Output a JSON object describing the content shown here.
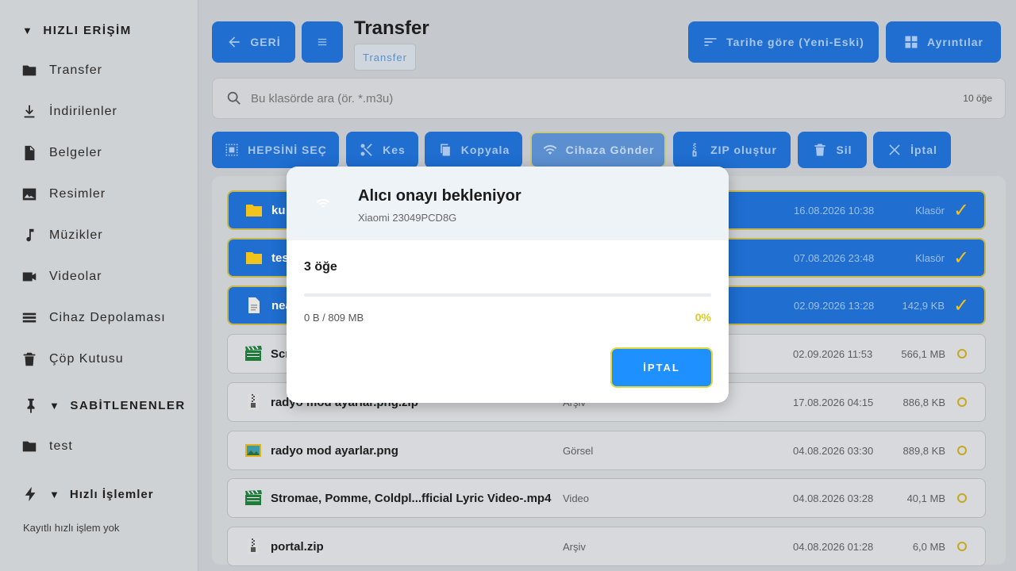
{
  "sidebar": {
    "quick_access": "HIZLI ERİŞİM",
    "items": [
      {
        "label": "Transfer",
        "icon": "folder-icon"
      },
      {
        "label": "İndirilenler",
        "icon": "download-icon"
      },
      {
        "label": "Belgeler",
        "icon": "document-icon"
      },
      {
        "label": "Resimler",
        "icon": "image-icon"
      },
      {
        "label": "Müzikler",
        "icon": "music-icon"
      },
      {
        "label": "Videolar",
        "icon": "video-icon"
      },
      {
        "label": "Cihaz Depolaması",
        "icon": "storage-icon"
      },
      {
        "label": "Çöp Kutusu",
        "icon": "trash-icon"
      }
    ],
    "pinned": "SABİTLENENLER",
    "pinned_items": [
      {
        "label": "test",
        "icon": "folder-icon"
      }
    ],
    "quick_actions": "Hızlı İşlemler",
    "quick_actions_empty": "Kayıtlı hızlı işlem yok"
  },
  "header": {
    "back_label": "GERİ",
    "title": "Transfer",
    "breadcrumb": "Transfer",
    "sort_label": "Tarihe göre (Yeni-Eski)",
    "view_label": "Ayrıntılar"
  },
  "search": {
    "placeholder": "Bu klasörde ara (ör. *.m3u)",
    "count": "10 öğe"
  },
  "toolbar": {
    "select_all": "HEPSİNİ SEÇ",
    "cut": "Kes",
    "copy": "Kopyala",
    "send": "Cihaza Gönder",
    "zip": "ZIP oluştur",
    "delete": "Sil",
    "cancel": "İptal"
  },
  "files": [
    {
      "name": "ku",
      "type": "",
      "date": "16.08.2026 10:38",
      "size": "Klasör",
      "selected": true
    },
    {
      "name": "tes",
      "type": "",
      "date": "07.08.2026 23:48",
      "size": "Klasör",
      "selected": true
    },
    {
      "name": "nea",
      "type": "",
      "date": "02.09.2026 13:28",
      "size": "142,9 KB",
      "selected": true
    },
    {
      "name": "Scr",
      "type": "",
      "date": "02.09.2026 11:53",
      "size": "566,1 MB",
      "selected": false
    },
    {
      "name": "radyo mod ayarlar.png.zip",
      "type": "Arşiv",
      "date": "17.08.2026 04:15",
      "size": "886,8 KB",
      "selected": false
    },
    {
      "name": "radyo mod ayarlar.png",
      "type": "Görsel",
      "date": "04.08.2026 03:30",
      "size": "889,8 KB",
      "selected": false
    },
    {
      "name": "Stromae, Pomme, Coldpl...fficial Lyric Video-.mp4",
      "type": "Video",
      "date": "04.08.2026 03:28",
      "size": "40,1 MB",
      "selected": false
    },
    {
      "name": "portal.zip",
      "type": "Arşiv",
      "date": "04.08.2026 01:28",
      "size": "6,0 MB",
      "selected": false
    }
  ],
  "dialog": {
    "title": "Alıcı onayı bekleniyor",
    "device": "Xiaomi 23049PCD8G",
    "count": "3 öğe",
    "size": "0 B / 809 MB",
    "progress_percent": "0%",
    "cancel_label": "İPTAL"
  }
}
